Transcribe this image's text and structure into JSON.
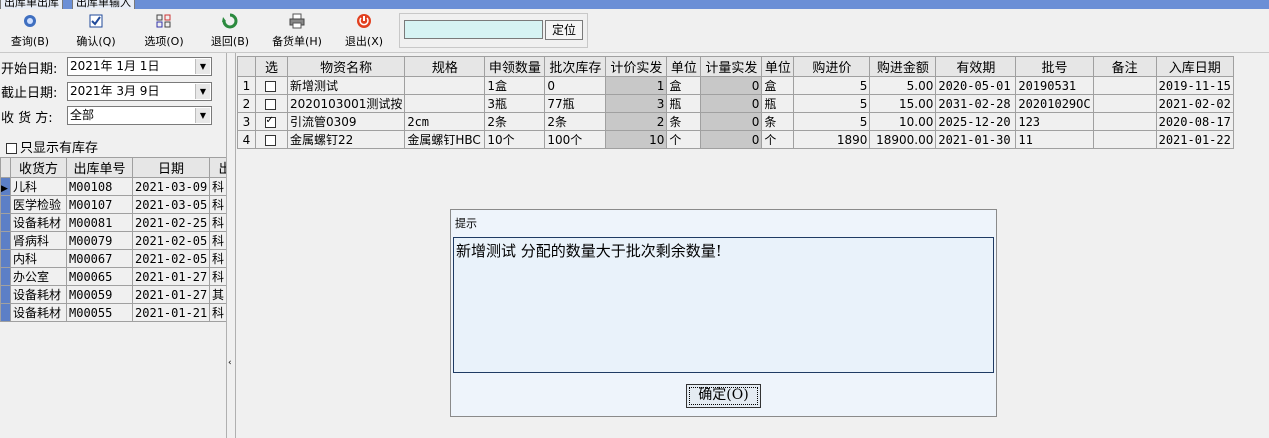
{
  "top_tabs": [
    "出库单出库",
    "出库单输入"
  ],
  "toolbar": {
    "items": [
      {
        "label": "查询(B)",
        "icon": "search-icon"
      },
      {
        "label": "确认(Q)",
        "icon": "confirm-icon"
      },
      {
        "label": "选项(O)",
        "icon": "options-icon"
      },
      {
        "label": "退回(B)",
        "icon": "return-icon"
      },
      {
        "label": "备货单(H)",
        "icon": "printer-icon"
      },
      {
        "label": "退出(X)",
        "icon": "power-icon"
      }
    ],
    "locate_value": "",
    "locate_label": "定位"
  },
  "filters": {
    "start_label": "开始日期:",
    "start_value": "2021年 1月 1日",
    "end_label": "截止日期:",
    "end_value": "2021年 3月 9日",
    "receiver_label": "收 货 方:",
    "receiver_value": "全部",
    "only_stock_label": "只显示有库存"
  },
  "left_table": {
    "headers": [
      "收货方",
      "出库单号",
      "日期",
      "出"
    ],
    "rows": [
      [
        "儿科",
        "M00108",
        "2021-03-09",
        "科"
      ],
      [
        "医学检验",
        "M00107",
        "2021-03-05",
        "科"
      ],
      [
        "设备耗材",
        "M00081",
        "2021-02-25",
        "科"
      ],
      [
        "肾病科",
        "M00079",
        "2021-02-05",
        "科"
      ],
      [
        "内科",
        "M00067",
        "2021-02-05",
        "科"
      ],
      [
        "办公室",
        "M00065",
        "2021-01-27",
        "科"
      ],
      [
        "设备耗材",
        "M00059",
        "2021-01-27",
        "其"
      ],
      [
        "设备耗材",
        "M00055",
        "2021-01-21",
        "科"
      ]
    ]
  },
  "main_table": {
    "headers": [
      "选",
      "物资名称",
      "规格",
      "申领数量",
      "批次库存",
      "计价实发",
      "单位",
      "计量实发",
      "单位",
      "购进价",
      "购进金额",
      "有效期",
      "批号",
      "备注",
      "入库日期"
    ],
    "rows": [
      {
        "no": "1",
        "checked": false,
        "name": "新增测试",
        "spec": "",
        "req": "1盒",
        "batch": "0",
        "priced": "1",
        "unit1": "盒",
        "meas": "0",
        "unit2": "盒",
        "price": "5",
        "amount": "5.00",
        "expiry": "2020-05-01",
        "lot": "20190531",
        "note": "",
        "indate": "2019-11-15"
      },
      {
        "no": "2",
        "checked": false,
        "name": "2020103001测试按",
        "spec": "",
        "req": "3瓶",
        "batch": "77瓶",
        "priced": "3",
        "unit1": "瓶",
        "meas": "0",
        "unit2": "瓶",
        "price": "5",
        "amount": "15.00",
        "expiry": "2031-02-28",
        "lot": "20201029OC",
        "note": "",
        "indate": "2021-02-02"
      },
      {
        "no": "3",
        "checked": true,
        "name": "引流管0309",
        "spec": "2cm",
        "req": "2条",
        "batch": "2条",
        "priced": "2",
        "unit1": "条",
        "meas": "0",
        "unit2": "条",
        "price": "5",
        "amount": "10.00",
        "expiry": "2025-12-20",
        "lot": "123",
        "note": "",
        "indate": "2020-08-17"
      },
      {
        "no": "4",
        "checked": false,
        "name": "金属螺钉22",
        "spec": "金属螺钉HBC",
        "req": "10个",
        "batch": "100个",
        "priced": "10",
        "unit1": "个",
        "meas": "0",
        "unit2": "个",
        "price": "1890",
        "amount": "18900.00",
        "expiry": "2021-01-30",
        "lot": "11",
        "note": "",
        "indate": "2021-01-22"
      }
    ]
  },
  "dialog": {
    "title": "提示",
    "message": "新增测试 分配的数量大于批次剩余数量!",
    "ok_label": "确定(O)"
  }
}
